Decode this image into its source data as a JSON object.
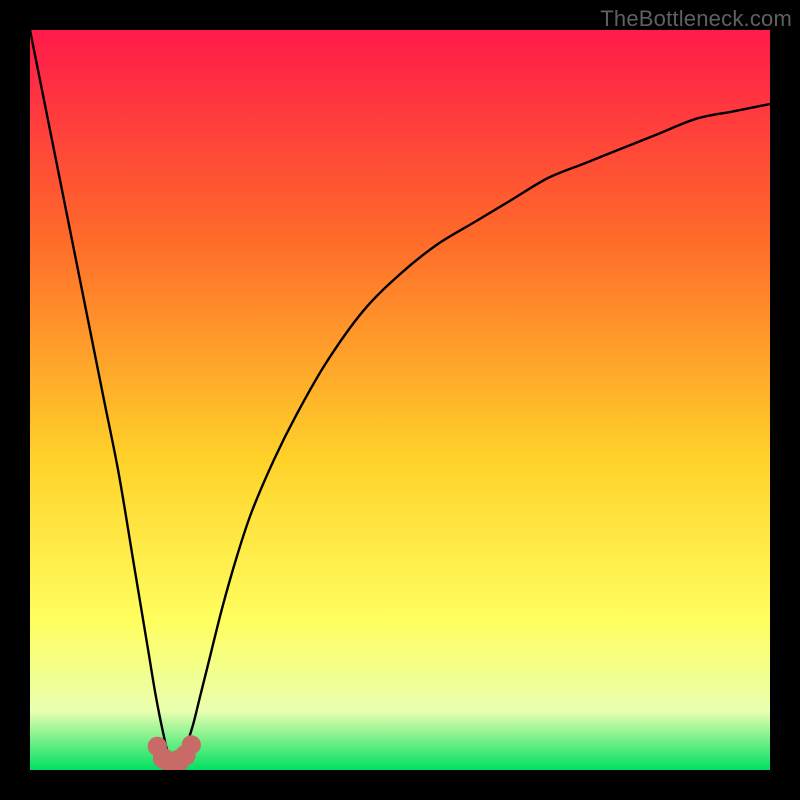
{
  "watermark": "TheBottleneck.com",
  "colors": {
    "gradient_top": "#ff1a4a",
    "gradient_mid1": "#ff6a2a",
    "gradient_mid2": "#ffd22a",
    "gradient_mid3": "#ffff60",
    "gradient_mid4": "#eaffb0",
    "gradient_bottom": "#00e060",
    "curve_stroke": "#000000",
    "dot_fill": "#c86a66",
    "frame_bg": "#000000"
  },
  "chart_data": {
    "type": "line",
    "title": "",
    "xlabel": "",
    "ylabel": "",
    "xlim": [
      0,
      100
    ],
    "ylim": [
      0,
      100
    ],
    "curve": {
      "description": "Bottleneck percentage curve with a deep sharp minimum near x≈19, rising steeply on both sides; left branch goes to 100 at x=0, right branch approaches ~90 by x=100.",
      "x": [
        0,
        2,
        4,
        6,
        8,
        10,
        12,
        14,
        15,
        16,
        17,
        18,
        19,
        20,
        21,
        22,
        23,
        24,
        26,
        28,
        30,
        33,
        36,
        40,
        45,
        50,
        55,
        60,
        65,
        70,
        75,
        80,
        85,
        90,
        95,
        100
      ],
      "y": [
        100,
        90,
        80,
        70,
        60,
        50,
        40,
        28,
        22,
        16,
        10,
        5,
        1,
        1,
        3,
        6,
        10,
        14,
        22,
        29,
        35,
        42,
        48,
        55,
        62,
        67,
        71,
        74,
        77,
        80,
        82,
        84,
        86,
        88,
        89,
        90
      ]
    },
    "dots": {
      "description": "Cluster of circular markers at the curve minimum (the 'sweet spot').",
      "points": [
        {
          "x": 17.2,
          "y": 3.2,
          "r": 1.3
        },
        {
          "x": 18.0,
          "y": 1.6,
          "r": 1.4
        },
        {
          "x": 19.0,
          "y": 1.0,
          "r": 1.5
        },
        {
          "x": 20.0,
          "y": 1.2,
          "r": 1.5
        },
        {
          "x": 21.0,
          "y": 2.0,
          "r": 1.4
        },
        {
          "x": 21.8,
          "y": 3.4,
          "r": 1.3
        }
      ]
    }
  }
}
